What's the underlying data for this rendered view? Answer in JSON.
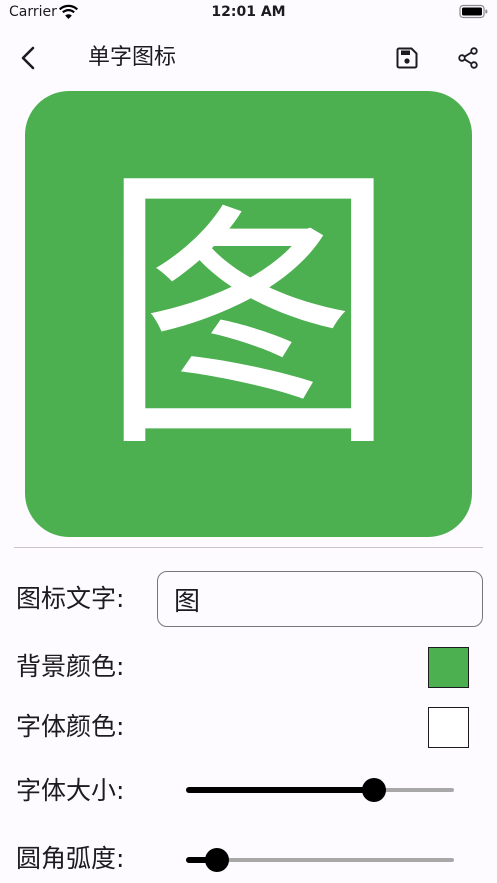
{
  "status_bar": {
    "carrier": "Carrier",
    "time": "12:01 AM"
  },
  "app_bar": {
    "title": "单字图标",
    "icons": [
      "back-arrow-icon",
      "save-icon",
      "share-icon"
    ]
  },
  "preview": {
    "glyph": "图",
    "background_color": "#4caf50",
    "text_color": "#ffffff"
  },
  "form": {
    "icon_text_label": "图标文字:",
    "icon_text_value": "图",
    "background_color_label": "背景颜色:",
    "background_color_value": "#4caf50",
    "font_color_label": "字体颜色:",
    "font_color_value": "#ffffff",
    "font_size_label": "字体大小:",
    "font_size_fraction": 0.7,
    "corner_radius_label": "圆角弧度:",
    "corner_radius_fraction": 0.115
  }
}
